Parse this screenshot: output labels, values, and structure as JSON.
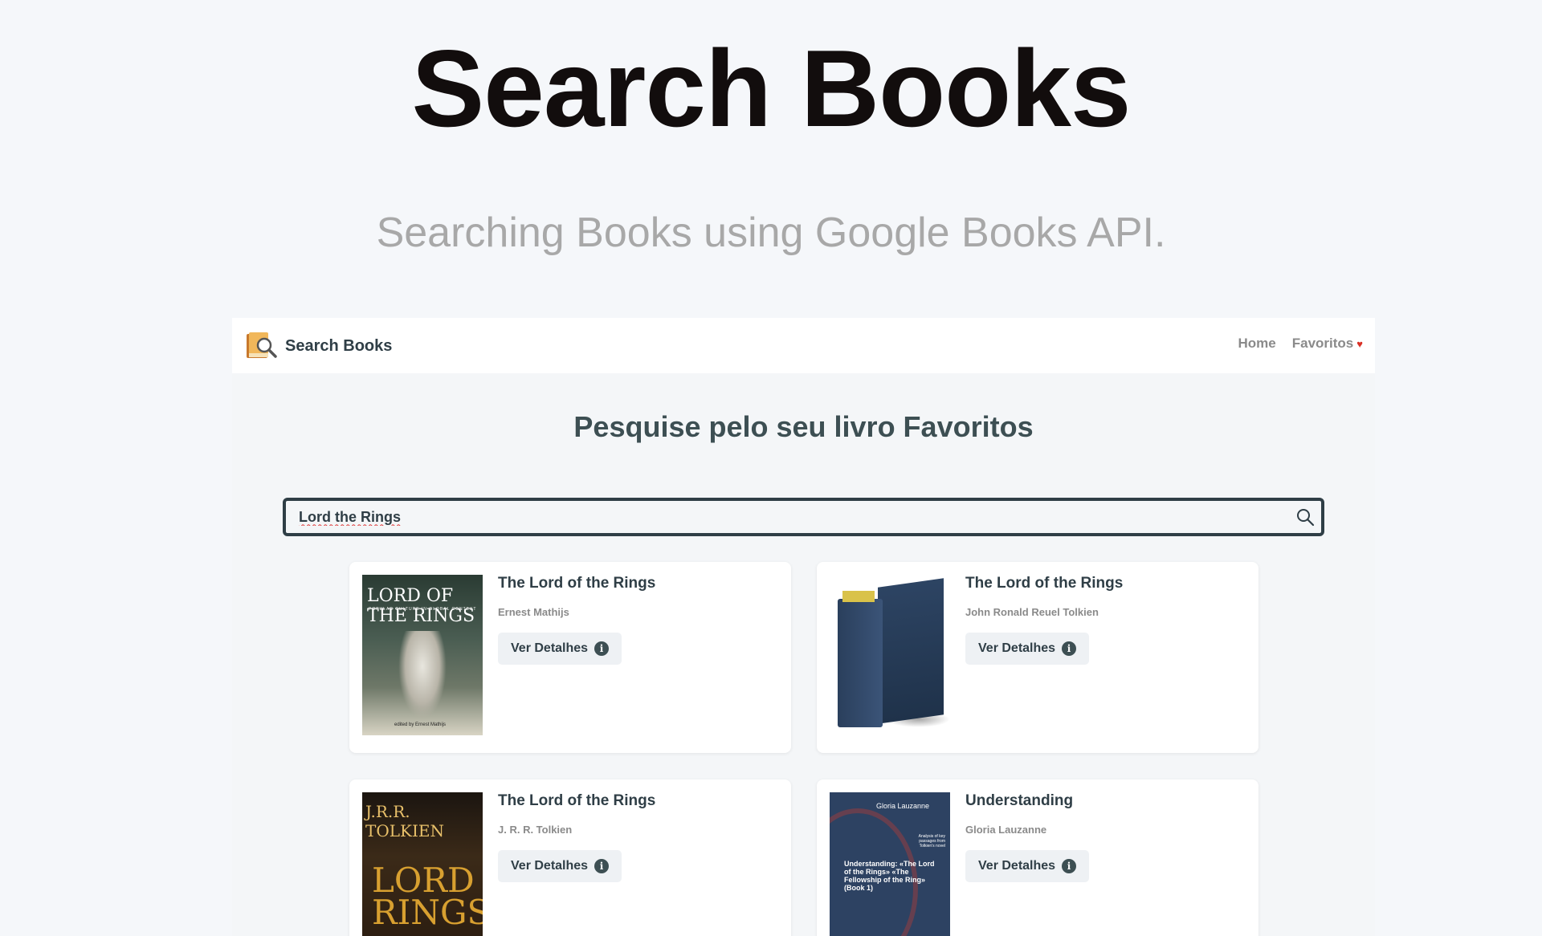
{
  "hero": {
    "title": "Search Books",
    "subtitle": "Searching Books using Google Books API."
  },
  "navbar": {
    "brand_name": "Search Books",
    "links": [
      {
        "label": "Home"
      },
      {
        "label": "Favoritos"
      }
    ]
  },
  "main": {
    "heading": "Pesquise pelo seu livro Favoritos",
    "search_value": "Lord the Rings"
  },
  "results": [
    {
      "title": "The Lord of the Rings",
      "author": "Ernest Mathijs",
      "button_label": "Ver Detalhes",
      "cover_text": "LORD OF THE RINGS",
      "cover_subtext": "POPULAR CULTURE IN GLOBAL CONTEXT",
      "cover_foot": "edited by Ernest Mathijs"
    },
    {
      "title": "The Lord of the Rings",
      "author": "John Ronald Reuel Tolkien",
      "button_label": "Ver Detalhes"
    },
    {
      "title": "The Lord of the Rings",
      "author": "J. R. R. Tolkien",
      "button_label": "Ver Detalhes",
      "cover_text": "J.R.R. TOLKIEN",
      "cover_big": "LORD RINGS"
    },
    {
      "title": "Understanding",
      "author": "Gloria Lauzanne",
      "button_label": "Ver Detalhes",
      "cover_top": "Gloria Lauzanne",
      "cover_mid": "Analysis of key passages from Tolkien's novel",
      "cover_body": "Understanding: «The Lord of the Rings» «The Fellowship of the Ring» (Book 1)"
    }
  ],
  "colors": {
    "page_bg": "#f5f7fa",
    "accent": "#2f3e46",
    "heart": "#d93025"
  }
}
